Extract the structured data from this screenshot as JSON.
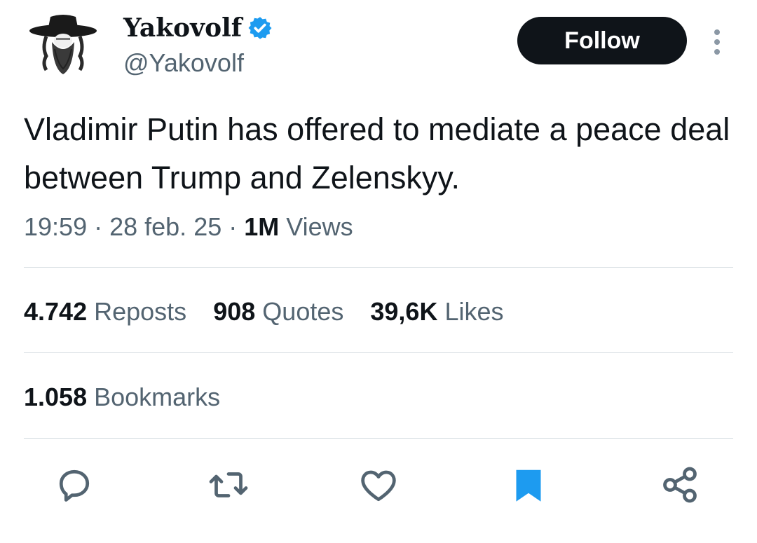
{
  "user": {
    "display_name": "Yakovolf",
    "handle": "@Yakovolf",
    "verified": true,
    "avatar_icon": "hasidic-hat-beard-avatar"
  },
  "header": {
    "follow_label": "Follow",
    "more_icon": "more-vertical-icon"
  },
  "tweet": {
    "text": "Vladimir Putin has offered to mediate a peace deal between Trump and Zelenskyy."
  },
  "meta": {
    "time": "19:59",
    "separator": " · ",
    "date": "28 feb. 25",
    "views_count": "1M",
    "views_label": "Views"
  },
  "stats": {
    "reposts_count": "4.742",
    "reposts_label": "Reposts",
    "quotes_count": "908",
    "quotes_label": "Quotes",
    "likes_count": "39,6K",
    "likes_label": "Likes",
    "bookmarks_count": "1.058",
    "bookmarks_label": "Bookmarks"
  },
  "actions": [
    {
      "icon": "reply-icon"
    },
    {
      "icon": "repost-icon"
    },
    {
      "icon": "like-icon"
    },
    {
      "icon": "bookmark-icon",
      "active": true
    },
    {
      "icon": "share-icon"
    }
  ],
  "colors": {
    "text_primary": "#0f1419",
    "text_secondary": "#536471",
    "accent_blue": "#1d9bf0",
    "divider": "#d6dde2",
    "follow_bg": "#0f1419"
  }
}
